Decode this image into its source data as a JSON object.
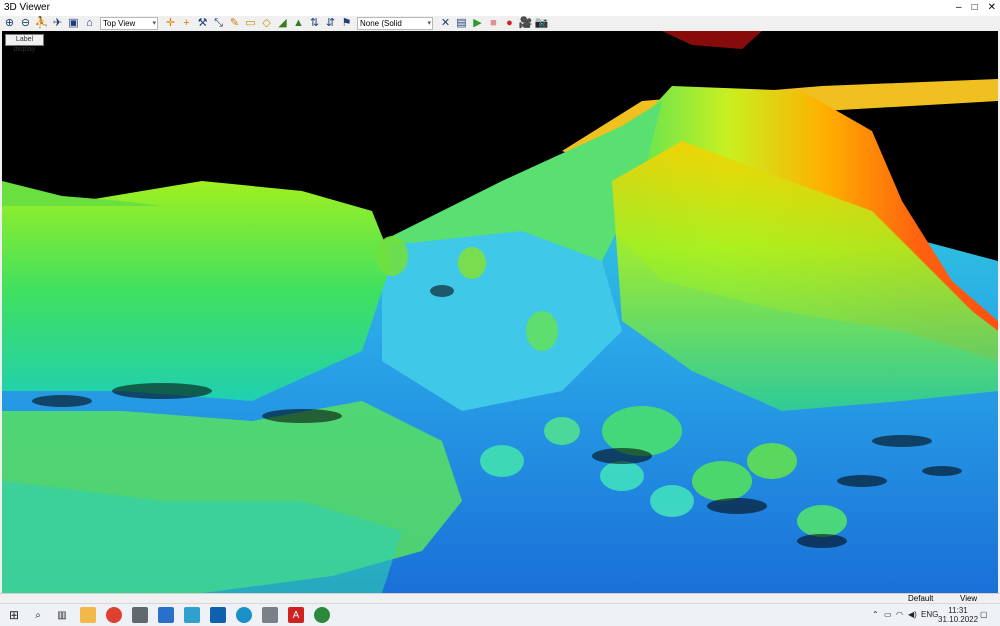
{
  "window": {
    "title": "3D Viewer",
    "minimize": "–",
    "maximize": "□",
    "close": "✕"
  },
  "toolbar": {
    "view_select": "Top View",
    "background_select": "None (Solid Background"
  },
  "viewport": {
    "label_display": "Label display"
  },
  "statusbar": {
    "mode": "Default",
    "context": "View"
  },
  "taskbar": {
    "language": "ENG",
    "time": "11:31",
    "date": "31.10.2022",
    "apps": [
      {
        "icon": "windows-start-icon"
      },
      {
        "icon": "search-icon"
      },
      {
        "icon": "task-view-icon"
      },
      {
        "icon": "file-explorer-icon"
      },
      {
        "icon": "chrome-icon"
      },
      {
        "icon": "calculator-icon"
      },
      {
        "icon": "app-icon"
      },
      {
        "icon": "mail-icon"
      },
      {
        "icon": "outlook-icon"
      },
      {
        "icon": "edge-icon"
      },
      {
        "icon": "app-icon"
      },
      {
        "icon": "acrobat-icon"
      },
      {
        "icon": "app-icon"
      }
    ]
  }
}
